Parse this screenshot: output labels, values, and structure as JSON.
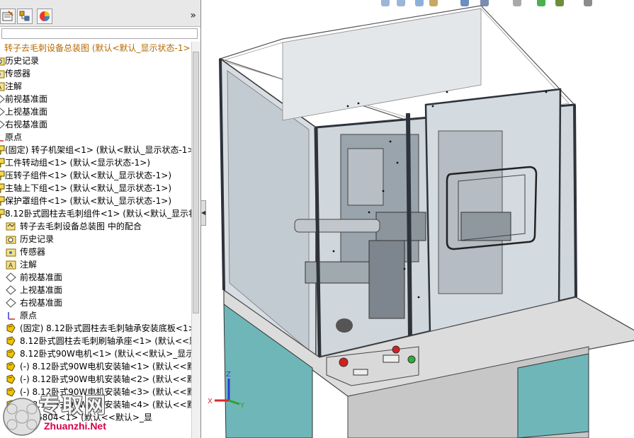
{
  "feature_tree": {
    "expand_symbol": "»",
    "filter_value": "",
    "items": [
      {
        "label": "转子去毛刺设备总装图  (默认<默认_显示状态-1>",
        "icon": "assembly-icon"
      },
      {
        "label": "历史记录",
        "icon": "history-folder-icon"
      },
      {
        "label": "传感器",
        "icon": "sensor-folder-icon"
      },
      {
        "label": "注解",
        "icon": "annotation-folder-icon"
      },
      {
        "label": "前视基准面",
        "icon": "plane-icon"
      },
      {
        "label": "上视基准面",
        "icon": "plane-icon"
      },
      {
        "label": "右视基准面",
        "icon": "plane-icon"
      },
      {
        "label": "原点",
        "icon": "origin-icon"
      },
      {
        "label": "(固定) 转子机架组<1> (默认<默认_显示状态-1>",
        "icon": "subassembly-icon"
      },
      {
        "label": "工件转动组<1> (默认<显示状态-1>)",
        "icon": "subassembly-icon"
      },
      {
        "label": "压转子组件<1> (默认<默认_显示状态-1>)",
        "icon": "subassembly-icon"
      },
      {
        "label": "主轴上下组<1> (默认<默认_显示状态-1>)",
        "icon": "subassembly-icon"
      },
      {
        "label": "保护罩组件<1> (默认<默认_显示状态-1>)",
        "icon": "subassembly-icon"
      },
      {
        "label": "8.12卧式圆柱去毛刺组件<1> (默认<默认_显示状",
        "icon": "subassembly-icon"
      },
      {
        "label": "转子去毛刺设备总装图 中的配合",
        "icon": "mates-icon"
      },
      {
        "label": "历史记录",
        "icon": "history-folder-icon"
      },
      {
        "label": "传感器",
        "icon": "sensor-folder-icon"
      },
      {
        "label": "注解",
        "icon": "annotation-folder-icon"
      },
      {
        "label": "前视基准面",
        "icon": "plane-icon"
      },
      {
        "label": "上视基准面",
        "icon": "plane-icon"
      },
      {
        "label": "右视基准面",
        "icon": "plane-icon"
      },
      {
        "label": "原点",
        "icon": "origin-icon"
      },
      {
        "label": "(固定) 8.12卧式圆柱去毛刺轴承安装底板<1>",
        "icon": "part-icon"
      },
      {
        "label": "8.12卧式圆柱去毛刺刷轴承座<1> (默认<<默",
        "icon": "part-icon"
      },
      {
        "label": "8.12卧式90W电机<1> (默认<<默认>_显示状",
        "icon": "part-icon"
      },
      {
        "label": "(-) 8.12卧式90W电机安装轴<1> (默认<<默认",
        "icon": "part-icon"
      },
      {
        "label": "(-) 8.12卧式90W电机安装轴<2> (默认<<默认",
        "icon": "part-icon"
      },
      {
        "label": "(-) 8.12卧式90W电机安装轴<3> (默认<<默认",
        "icon": "part-icon"
      },
      {
        "label": "(-) 8.12卧式90W电机安装轴<4> (默认<<默认",
        "icon": "part-icon"
      },
      {
        "label": "轴承6804<1> (默认<<默认>_显",
        "icon": "part-icon"
      }
    ]
  },
  "triad": {
    "x": "X",
    "y": "Y",
    "z": "Z"
  },
  "watermark": {
    "chinese": "专取网",
    "english": "Zhuanzhi.Net"
  },
  "colors": {
    "accent_root": "#b46900",
    "frame_dark": "#3a3f4a",
    "glass": "#cfd6dc",
    "base_teal": "#6fb6b8",
    "wm_red": "#d6004a"
  }
}
